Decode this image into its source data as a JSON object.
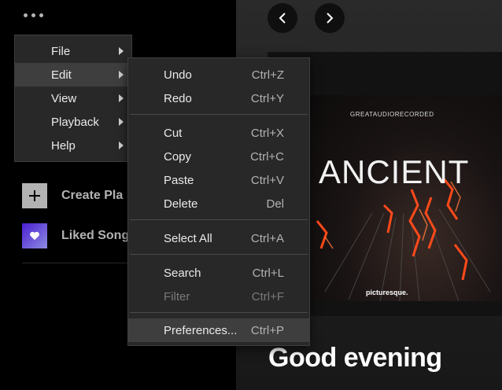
{
  "sidebar": {
    "items": [
      {
        "label": "Create Pla",
        "icon": "plus-icon"
      },
      {
        "label": "Liked Song",
        "icon": "heart-icon"
      }
    ]
  },
  "main_menu": {
    "items": [
      {
        "label": "File"
      },
      {
        "label": "Edit"
      },
      {
        "label": "View"
      },
      {
        "label": "Playback"
      },
      {
        "label": "Help"
      }
    ]
  },
  "edit_menu": {
    "items": [
      {
        "label": "Undo",
        "shortcut": "Ctrl+Z"
      },
      {
        "label": "Redo",
        "shortcut": "Ctrl+Y"
      },
      {
        "label": "Cut",
        "shortcut": "Ctrl+X"
      },
      {
        "label": "Copy",
        "shortcut": "Ctrl+C"
      },
      {
        "label": "Paste",
        "shortcut": "Ctrl+V"
      },
      {
        "label": "Delete",
        "shortcut": "Del"
      },
      {
        "label": "Select All",
        "shortcut": "Ctrl+A"
      },
      {
        "label": "Search",
        "shortcut": "Ctrl+L"
      },
      {
        "label": "Filter",
        "shortcut": "Ctrl+F"
      },
      {
        "label": "Preferences...",
        "shortcut": "Ctrl+P"
      }
    ]
  },
  "album": {
    "label_top": "GREATAUDIORECORDED",
    "title": "ANCIENT",
    "label_bottom": "picturesque."
  },
  "main": {
    "greeting": "Good evening"
  },
  "colors": {
    "menu_bg": "#282828",
    "menu_highlight": "#3e3e3e",
    "album_accent": "#ff4a1a"
  }
}
